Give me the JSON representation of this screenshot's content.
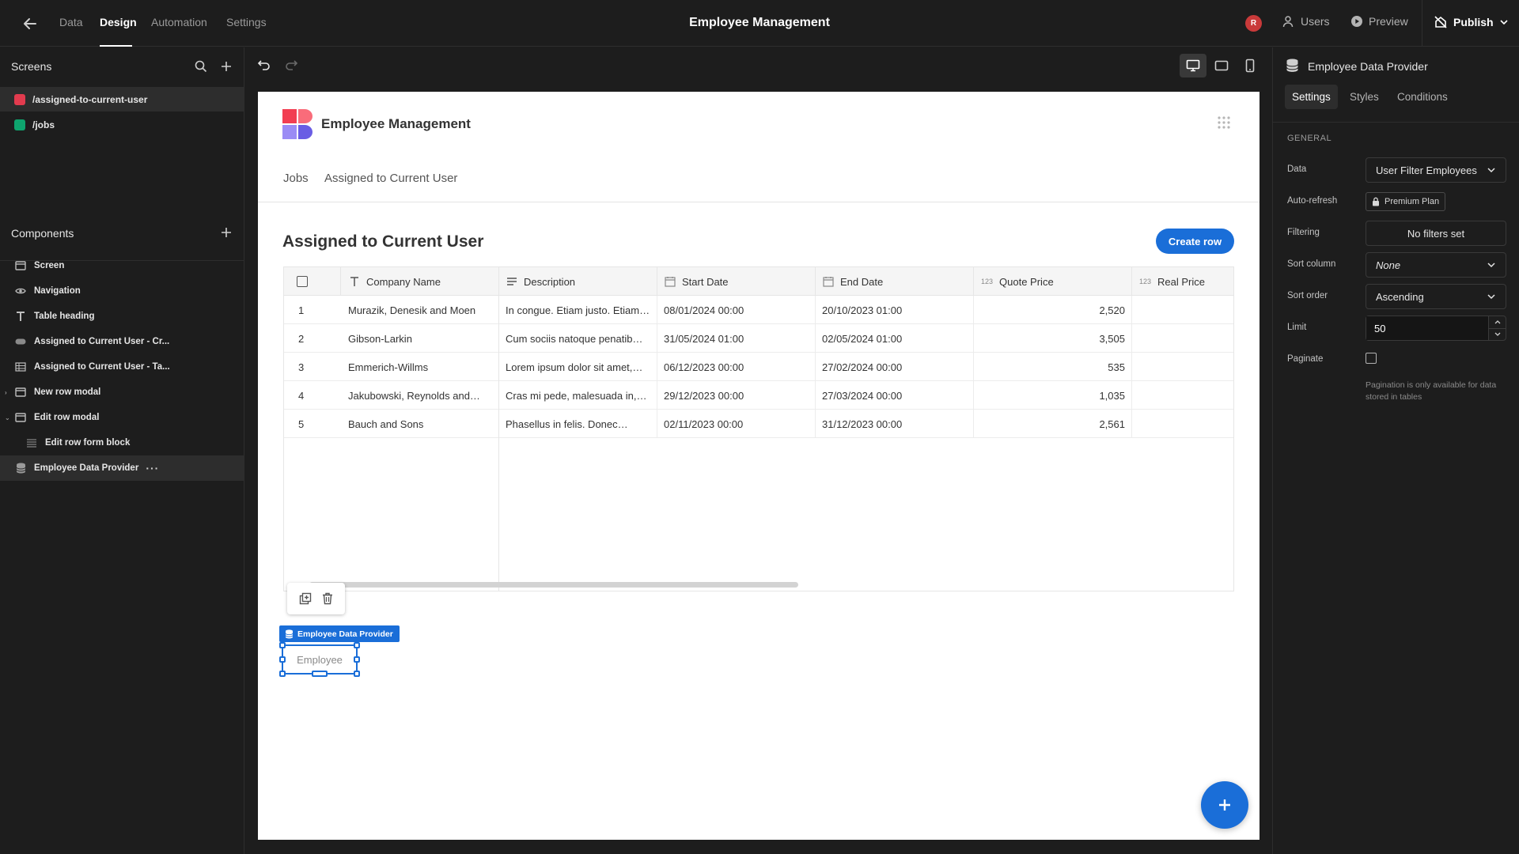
{
  "topbar": {
    "tabs": [
      "Data",
      "Design",
      "Automation",
      "Settings"
    ],
    "active_tab": "Design",
    "app_title": "Employee Management",
    "avatar_initial": "R",
    "users_label": "Users",
    "preview_label": "Preview",
    "publish_label": "Publish"
  },
  "screens": {
    "heading": "Screens",
    "items": [
      {
        "label": "/assigned-to-current-user",
        "color": "#e23b4e"
      },
      {
        "label": "/jobs",
        "color": "#0ea46e"
      }
    ]
  },
  "components": {
    "heading": "Components",
    "items": [
      {
        "label": "Screen",
        "icon": "screen-icon"
      },
      {
        "label": "Navigation",
        "icon": "eye-icon"
      },
      {
        "label": "Table heading",
        "icon": "text-icon"
      },
      {
        "label": "Assigned to Current User - Cr...",
        "icon": "button-icon"
      },
      {
        "label": "Assigned to Current User - Ta...",
        "icon": "table-icon"
      },
      {
        "label": "New row modal",
        "icon": "modal-icon"
      },
      {
        "label": "Edit row modal",
        "icon": "modal-icon"
      },
      {
        "label": "Edit row form block",
        "icon": "form-icon"
      },
      {
        "label": "Employee Data Provider",
        "icon": "database-icon"
      }
    ]
  },
  "page": {
    "app_name": "Employee Management",
    "nav": [
      "Jobs",
      "Assigned to Current User"
    ],
    "heading": "Assigned to Current User",
    "create_button": "Create row",
    "table": {
      "columns": [
        "Company Name",
        "Description",
        "Start Date",
        "End Date",
        "Quote Price",
        "Real Price"
      ],
      "number_badge": "123",
      "rows": [
        {
          "n": "1",
          "company": "Murazik, Denesik and Moen",
          "desc": "In congue. Etiam justo. Etiam…",
          "start": "08/01/2024 00:00",
          "end": "20/10/2023 01:00",
          "quote": "2,520",
          "real": ""
        },
        {
          "n": "2",
          "company": "Gibson-Larkin",
          "desc": "Cum sociis natoque penatib…",
          "start": "31/05/2024 01:00",
          "end": "02/05/2024 01:00",
          "quote": "3,505",
          "real": ""
        },
        {
          "n": "3",
          "company": "Emmerich-Willms",
          "desc": "Lorem ipsum dolor sit amet,…",
          "start": "06/12/2023 00:00",
          "end": "27/02/2024 00:00",
          "quote": "535",
          "real": ""
        },
        {
          "n": "4",
          "company": "Jakubowski, Reynolds and…",
          "desc": "Cras mi pede, malesuada in,…",
          "start": "29/12/2023 00:00",
          "end": "27/03/2024 00:00",
          "quote": "1,035",
          "real": ""
        },
        {
          "n": "5",
          "company": "Bauch and Sons",
          "desc": "Phasellus in felis. Donec…",
          "start": "02/11/2023 00:00",
          "end": "31/12/2023 00:00",
          "quote": "2,561",
          "real": ""
        }
      ]
    },
    "provider_tag": "Employee Data Provider",
    "provider_placeholder": "Employee"
  },
  "settings": {
    "title": "Employee Data Provider",
    "tabs": [
      "Settings",
      "Styles",
      "Conditions"
    ],
    "section": "GENERAL",
    "data_label": "Data",
    "data_value": "User Filter Employees",
    "autorefresh_label": "Auto-refresh",
    "autorefresh_value": "Premium Plan",
    "filtering_label": "Filtering",
    "filtering_value": "No filters set",
    "sortcol_label": "Sort column",
    "sortcol_value": "None",
    "sortorder_label": "Sort order",
    "sortorder_value": "Ascending",
    "limit_label": "Limit",
    "limit_value": "50",
    "paginate_label": "Paginate",
    "paginate_note": "Pagination is only available for data stored in tables"
  }
}
